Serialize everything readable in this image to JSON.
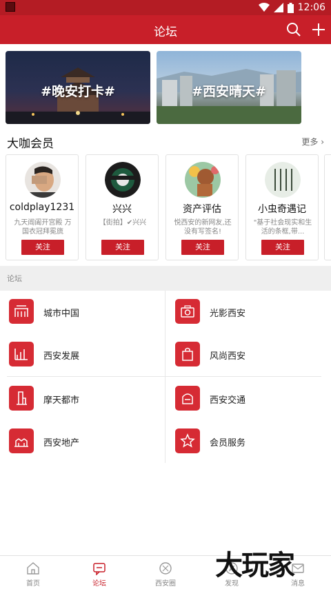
{
  "status_bar": {
    "time": "12:06",
    "app_icon": "app-icon",
    "wifi": "wifi-icon",
    "signal": "signal-icon",
    "battery": "battery-icon"
  },
  "header": {
    "title": "论坛",
    "search_icon": "search-icon",
    "add_icon": "add-icon"
  },
  "banners": [
    {
      "text": "#晚安打卡#"
    },
    {
      "text": "#西安晴天#"
    }
  ],
  "members_section": {
    "title": "大咖会员",
    "more_label": "更多",
    "members": [
      {
        "name": "coldplay1231",
        "desc": "九天阊阖开宫殿 万国衣冠拜冕旒",
        "follow": "关注"
      },
      {
        "name": "兴兴",
        "desc": "【街拍】✔兴兴",
        "follow": "关注"
      },
      {
        "name": "资产评估",
        "desc": "悦西安的新网友,还没有写签名!",
        "follow": "关注"
      },
      {
        "name": "小虫奇遇记",
        "desc": "\"基于社会现实和生活的条框,带...",
        "follow": "关注"
      }
    ]
  },
  "forum": {
    "section_label": "论坛",
    "items": [
      {
        "label": "城市中国",
        "icon": "city-gate-icon"
      },
      {
        "label": "光影西安",
        "icon": "camera-icon"
      },
      {
        "label": "西安发展",
        "icon": "growth-chart-icon"
      },
      {
        "label": "风尚西安",
        "icon": "shopping-bag-icon"
      },
      {
        "label": "摩天都市",
        "icon": "skyscraper-icon"
      },
      {
        "label": "西安交通",
        "icon": "car-seat-icon"
      },
      {
        "label": "西安地产",
        "icon": "building-icon"
      },
      {
        "label": "会员服务",
        "icon": "star-icon"
      }
    ]
  },
  "bottom_nav": [
    {
      "label": "首页",
      "icon": "home-icon"
    },
    {
      "label": "论坛",
      "icon": "forum-icon"
    },
    {
      "label": "西安圈",
      "icon": "circle-icon"
    },
    {
      "label": "发现",
      "icon": "discover-icon"
    },
    {
      "label": "消息",
      "icon": "message-icon"
    }
  ],
  "watermark": "大玩家",
  "colors": {
    "primary": "#c81f29",
    "status_bar": "#b41c24"
  }
}
